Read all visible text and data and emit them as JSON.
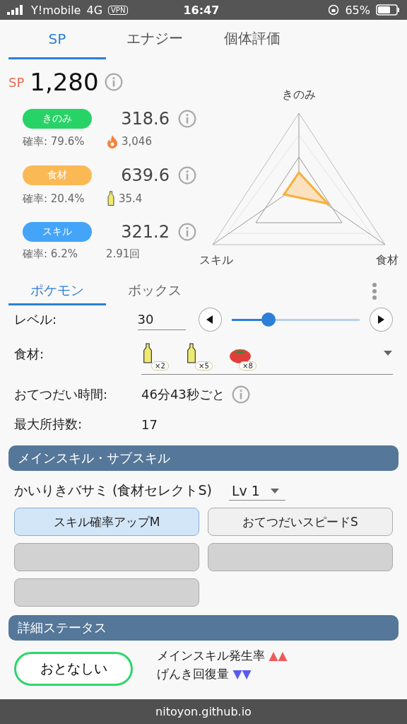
{
  "status_bar": {
    "carrier": "Y!mobile",
    "network": "4G",
    "vpn": "VPN",
    "time": "16:47",
    "battery": "65%"
  },
  "top_tabs": [
    {
      "label": "SP",
      "selected": true
    },
    {
      "label": "エナジー",
      "selected": false
    },
    {
      "label": "個体評価",
      "selected": false
    }
  ],
  "score": {
    "label": "SP",
    "value": "1,280"
  },
  "stats": [
    {
      "kind": "berry",
      "label": "きのみ",
      "color": "#27d366",
      "value": "318.6",
      "rate": "確率: 79.6%",
      "extra": "3,046"
    },
    {
      "kind": "ingredient",
      "label": "食材",
      "color": "#fbb955",
      "value": "639.6",
      "rate": "確率: 20.4%",
      "extra": "35.4"
    },
    {
      "kind": "skill",
      "label": "スキル",
      "color": "#44a4f8",
      "value": "321.2",
      "rate": "確率: 6.2%",
      "extra": "2.91回"
    }
  ],
  "radar": {
    "top": "きのみ",
    "left": "スキル",
    "right": "食材"
  },
  "pokemon_tabs": [
    {
      "label": "ポケモン",
      "selected": true
    },
    {
      "label": "ボックス",
      "selected": false
    }
  ],
  "level": {
    "label": "レベル:",
    "value": "30",
    "level": 0.29
  },
  "ingredients": {
    "label": "食材:",
    "items": [
      {
        "kind": "oil",
        "count": "×2"
      },
      {
        "kind": "oil",
        "count": "×5"
      },
      {
        "kind": "tomato",
        "count": "×8"
      }
    ]
  },
  "help_time": {
    "label": "おてつだい時間:",
    "value": "46分43秒ごと"
  },
  "max_carry": {
    "label": "最大所持数:",
    "value": "17"
  },
  "skills_section": {
    "title": "メインスキル・サブスキル",
    "main_skill": "かいりきバサミ (食材セレクトS)",
    "skill_level": "Lv 1",
    "subskills": [
      {
        "kind": "filled",
        "label": "スキル確率アップM",
        "selected": true
      },
      {
        "kind": "filled",
        "label": "おてつだいスピードS",
        "selected": false
      },
      {
        "kind": "empty"
      },
      {
        "kind": "empty"
      },
      {
        "kind": "empty"
      }
    ]
  },
  "details": {
    "title": "詳細ステータス",
    "nature": "おとなしい",
    "effects": [
      {
        "label": "メインスキル発生率",
        "marks": "▲▲",
        "kind": "up"
      },
      {
        "label": "げんき回復量",
        "marks": "▼▼",
        "kind": "down"
      }
    ]
  },
  "url": "nitoyon.github.io"
}
